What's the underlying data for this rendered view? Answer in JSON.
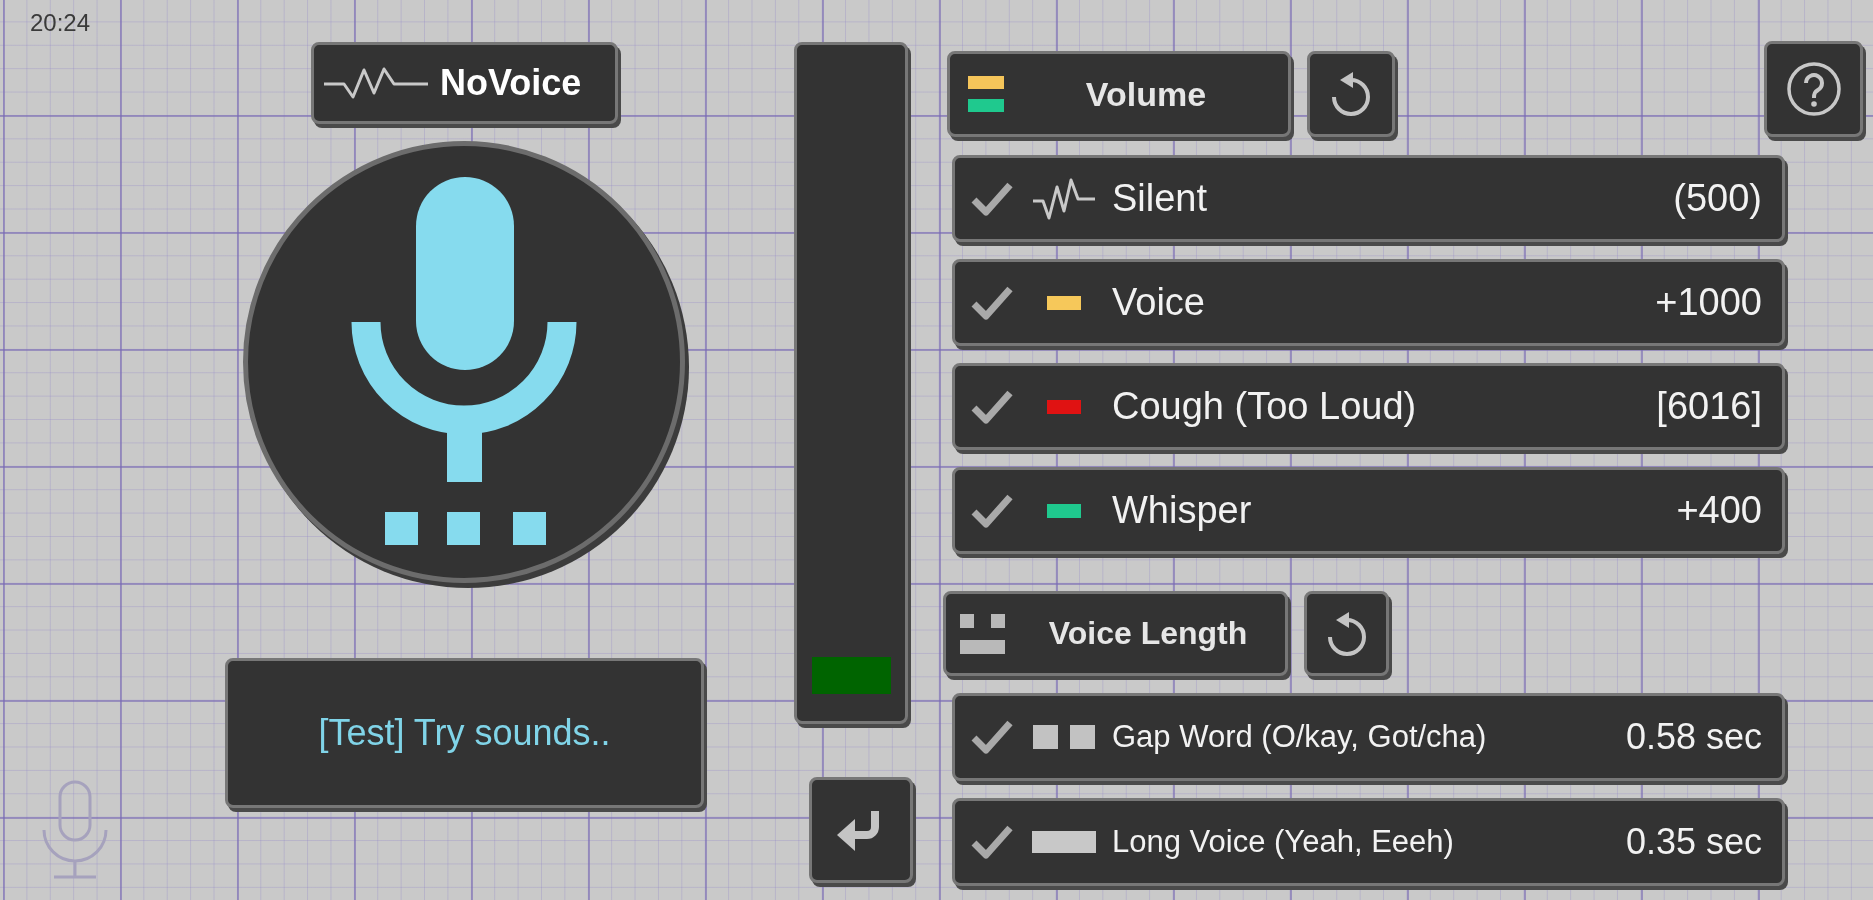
{
  "status_bar": {
    "time": "20:24"
  },
  "mode_button": {
    "label": "NoVoice"
  },
  "test_button": {
    "label": "[Test] Try sounds.."
  },
  "level_meter": {
    "level": 0.06
  },
  "volume": {
    "title": "Volume",
    "rows": [
      {
        "kind": "wave",
        "label": "Silent",
        "value": "(500)",
        "checked": true
      },
      {
        "kind": "swatch",
        "color": "#f6c85a",
        "label": "Voice",
        "value": "+1000",
        "checked": true
      },
      {
        "kind": "swatch",
        "color": "#e01212",
        "label": "Cough (Too Loud)",
        "value": "[6016]",
        "checked": true
      },
      {
        "kind": "swatch",
        "color": "#1fc98e",
        "label": "Whisper",
        "value": "+400",
        "checked": true
      }
    ]
  },
  "voice_length": {
    "title": "Voice Length",
    "rows": [
      {
        "kind": "gap",
        "label": "Gap Word (O/kay, Got/cha)",
        "value": "0.58 sec",
        "checked": true
      },
      {
        "kind": "long",
        "label": "Long Voice (Yeah, Eeeh)",
        "value": "0.35 sec",
        "checked": true
      }
    ]
  }
}
